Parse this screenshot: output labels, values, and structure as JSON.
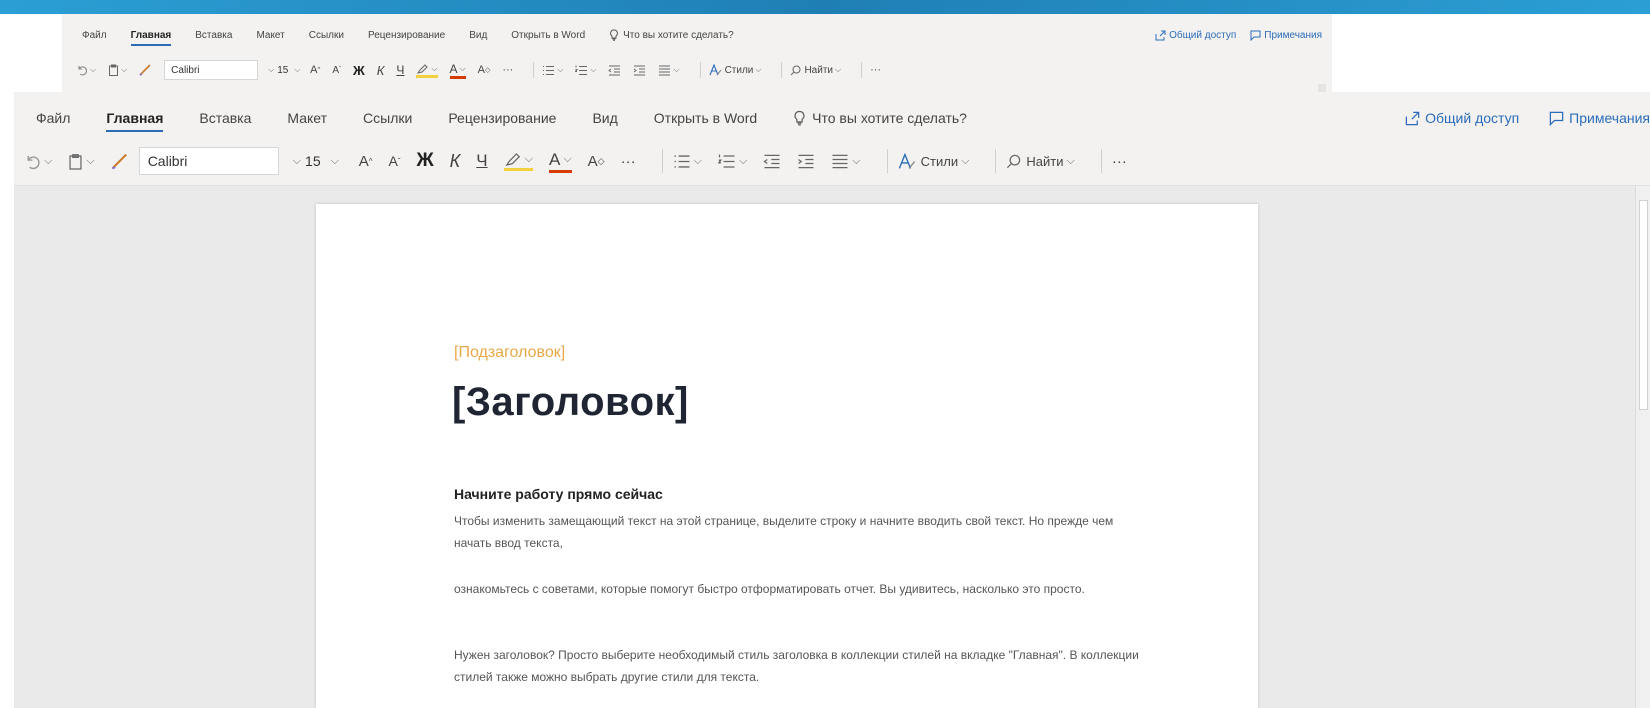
{
  "menu": {
    "file": "Файл",
    "home": "Главная",
    "insert": "Вставка",
    "layout": "Макет",
    "references": "Ссылки",
    "review": "Рецензирование",
    "view": "Вид",
    "open_in_word": "Открыть в Word",
    "tell_me": "Что вы хотите сделать?",
    "share": "Общий доступ",
    "comments": "Примечания"
  },
  "toolbar": {
    "font_name": "Calibri",
    "font_size": "15",
    "grow_font": "A",
    "shrink_font": "A",
    "bold": "Ж",
    "italic": "К",
    "underline": "Ч",
    "font_color": "A",
    "clear_format": "A",
    "more": "···",
    "styles": "Стили",
    "find": "Найти",
    "more_right": "···"
  },
  "document": {
    "subtitle": "[Подзаголовок]",
    "title": "[Заголовок]",
    "heading": "Начните работу прямо сейчас",
    "paragraphs": [
      "Чтобы изменить замещающий текст на этой странице, выделите строку и начните вводить свой текст. Но прежде чем начать ввод текста,",
      "ознакомьтесь с советами, которые помогут быстро отформатировать отчет. Вы удивитесь, насколько это просто.",
      "Нужен заголовок? Просто выберите необходимый стиль заголовка в коллекции стилей на вкладке \"Главная\". В коллекции стилей также можно выбрать другие стили для текста."
    ]
  },
  "colors": {
    "accent": "#2b6cb8",
    "subtitle": "#e8a847",
    "highlight": "#f2d23c",
    "font_color": "#d83b01"
  }
}
